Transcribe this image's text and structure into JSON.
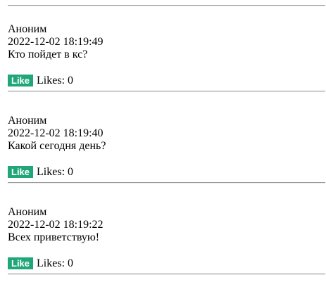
{
  "theme": {
    "like_button_color": "#21a67a"
  },
  "posts": [
    {
      "author": "Аноним",
      "timestamp": "2022-12-02 18:19:49",
      "text": "Кто пойдет в кс?",
      "like_label": "Like",
      "likes_text": "Likes: 0"
    },
    {
      "author": "Аноним",
      "timestamp": "2022-12-02 18:19:40",
      "text": "Какой сегодня день?",
      "like_label": "Like",
      "likes_text": "Likes: 0"
    },
    {
      "author": "Аноним",
      "timestamp": "2022-12-02 18:19:22",
      "text": "Всех приветствую!",
      "like_label": "Like",
      "likes_text": "Likes: 0"
    }
  ]
}
